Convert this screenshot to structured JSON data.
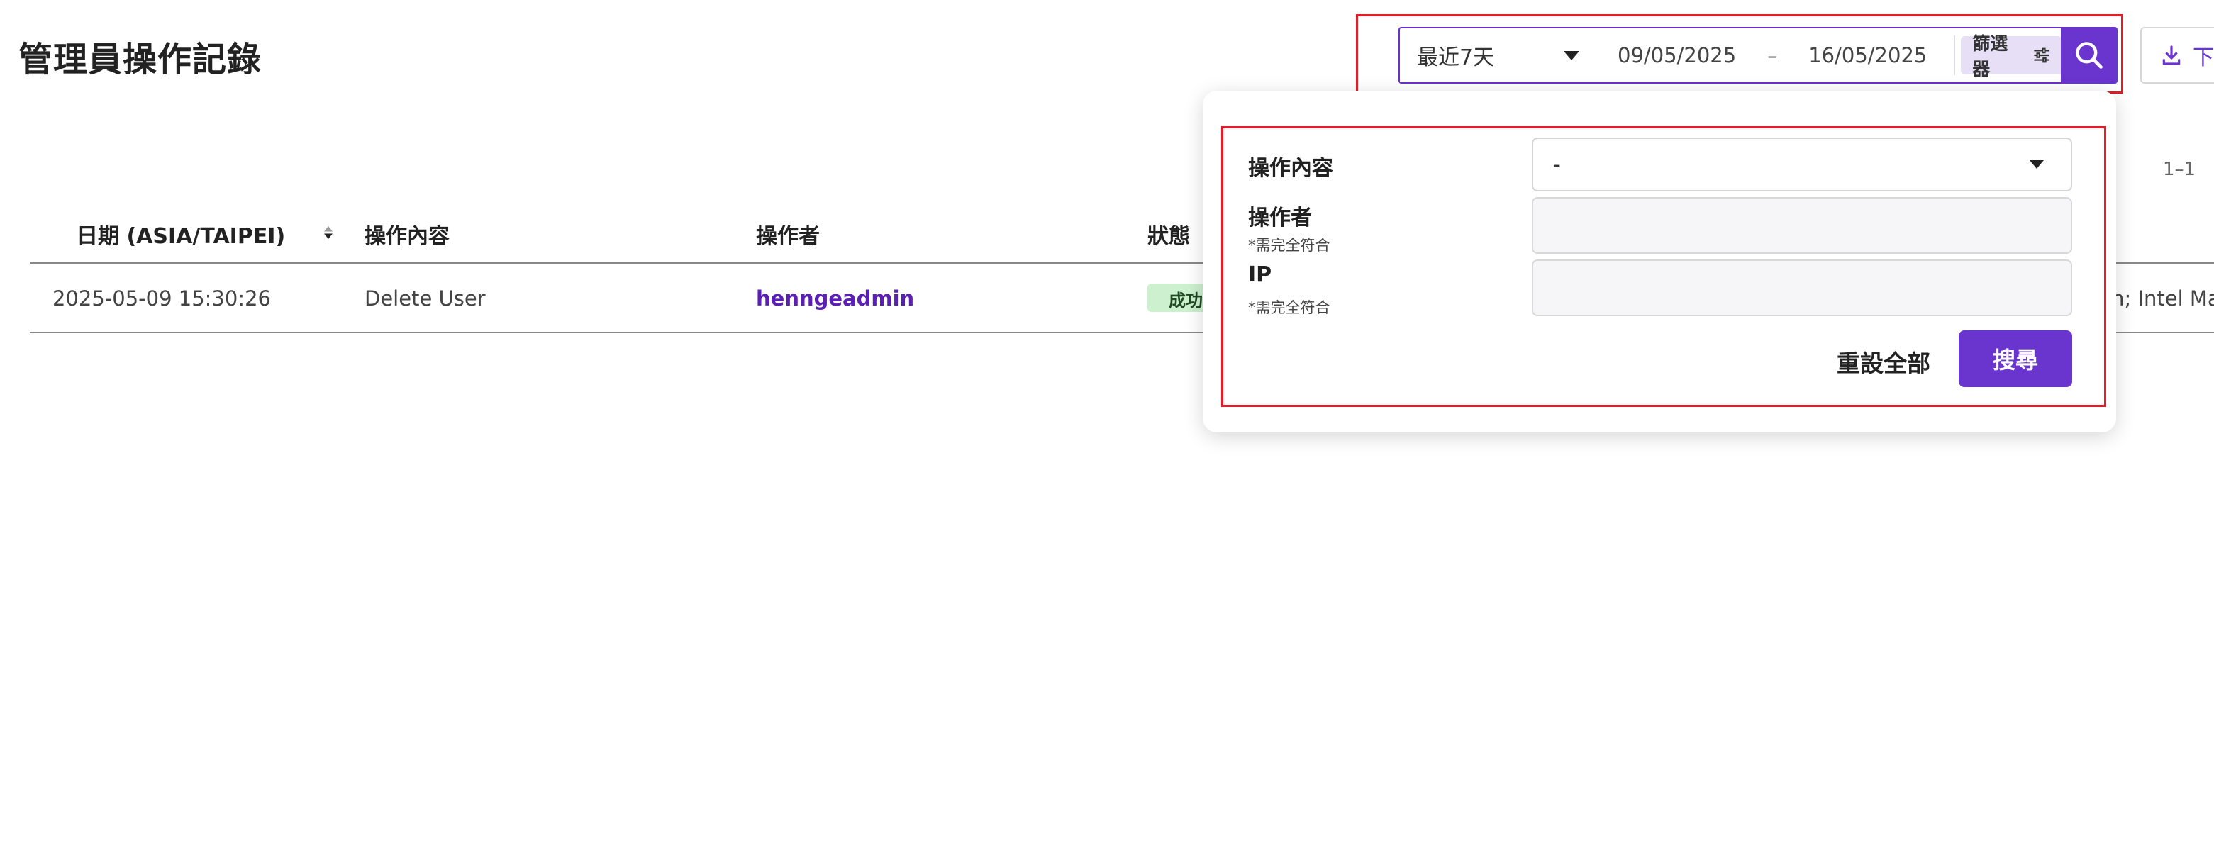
{
  "page": {
    "title": "管理員操作記錄"
  },
  "toolbar": {
    "range_value": "最近7天",
    "date_from": "09/05/2025",
    "date_separator": "–",
    "date_to": "16/05/2025",
    "filter_label": "篩選器",
    "download_label": "下",
    "accent_color": "#6a35cf"
  },
  "filter_panel": {
    "action_label": "操作內容",
    "action_value": "-",
    "operator_label": "操作者",
    "operator_note": "*需完全符合",
    "operator_value": "",
    "ip_label": "IP",
    "ip_note": "*需完全符合",
    "ip_value": "",
    "reset_label": "重設全部",
    "search_label": "搜尋"
  },
  "pagination": {
    "text": "1–1"
  },
  "table": {
    "columns": [
      "日期 (ASIA/TAIPEI)",
      "操作內容",
      "操作者",
      "狀態"
    ],
    "rows": [
      {
        "date": "2025-05-09 15:30:26",
        "action": "Delete User",
        "operator": "henngeadmin",
        "status": "成功",
        "agent_fragment": "sh; Intel Ma"
      }
    ]
  },
  "colors": {
    "highlight": "#e11d2a",
    "success_bg": "#cdf0cf"
  }
}
